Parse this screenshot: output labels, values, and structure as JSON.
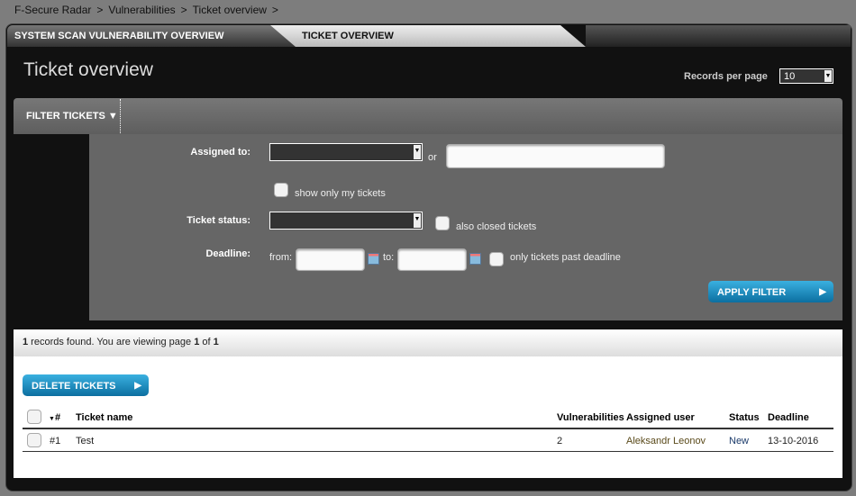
{
  "breadcrumb": [
    "F-Secure Radar",
    ">",
    "Vulnerabilities",
    ">",
    "Ticket overview",
    ">"
  ],
  "tabs": [
    {
      "label": "SYSTEM SCAN VULNERABILITY OVERVIEW",
      "active": false
    },
    {
      "label": "TICKET OVERVIEW",
      "active": true
    }
  ],
  "page_title": "Ticket overview",
  "records_per_page": {
    "label": "Records per page",
    "value": "10"
  },
  "filter": {
    "title": "FILTER TICKETS",
    "assigned_label": "Assigned to:",
    "or": "or",
    "assigned_value": "",
    "assigned_text": "",
    "show_mine": "show only my tickets",
    "status_label": "Ticket status:",
    "status_value": "",
    "also_closed": "also closed tickets",
    "deadline_label": "Deadline:",
    "from": "from:",
    "to": "to:",
    "past_deadline": "only tickets past deadline",
    "apply": "APPLY FILTER"
  },
  "results": {
    "count": "1",
    "text1": " records found. You are viewing page ",
    "page": "1",
    "of": " of ",
    "pages": "1"
  },
  "delete_button": "DELETE TICKETS",
  "table": {
    "columns": [
      "#",
      "Ticket name",
      "Vulnerabilities",
      "Assigned user",
      "Status",
      "Deadline"
    ],
    "rows": [
      {
        "id": "#1",
        "name": "Test",
        "vulns": "2",
        "user": "Aleksandr Leonov",
        "status": "New",
        "deadline": "13-10-2016"
      }
    ]
  },
  "colors": {
    "button": "#1a8cc4",
    "user": "#5a4a1a",
    "status": "#1a3a6a"
  }
}
